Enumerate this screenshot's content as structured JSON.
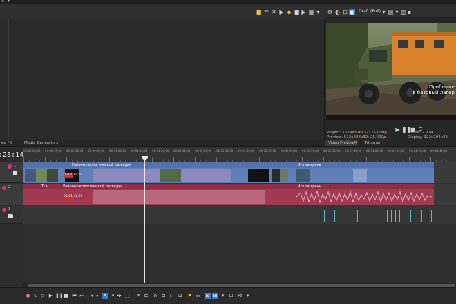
{
  "preview": {
    "quality": "Draft (Full)",
    "overlay_text_line1": "Прибытие",
    "overlay_text_line2": "в базовый лагер",
    "project_label": "Project:",
    "project_value": "1024x576x32; 25,000p",
    "preview_label": "Preview:",
    "preview_value": "512x288x32; 25,000p",
    "frame_label": "Frame:",
    "frame_value": "2 214",
    "display_label": "Display:",
    "display_value": "322x294x32"
  },
  "tabs": {
    "video_fx": "eo FX",
    "media_generators": "Media Generators",
    "video_preview": "Video Preview",
    "trimmer": "Trimmer"
  },
  "timeline": {
    "timecode": ":28:14",
    "ruler_labels": [
      "00:00:00;00",
      "00:00:15;00",
      "00:00:30;00",
      "00:00:45;00",
      "00:01:00;00",
      "00:01:15;00",
      "00:01:30;00",
      "00:01:45;00",
      "00:02:00;00",
      "00:02:15;00",
      "00:02:30;00",
      "00:02:45;00",
      "00:03:00;00",
      "00:03:15;00",
      "00:03:30;00",
      "00:03:45;00",
      "00:04:00;00",
      "00:04:15;00",
      "00:04:30;00",
      "00:04:45;00"
    ],
    "video_clip_1": "Районы геологической разведки",
    "video_clip_2": "Что за хрень",
    "audio_clip_short": "Тга...",
    "audio_clip_1": "Районы геологической разведки",
    "audio_clip_2": "Что за хрень",
    "marker_1": "00:01:40;01",
    "marker_2": "00:01:40;01",
    "track_1_num": "1",
    "track_2_num": "2",
    "track_3_num": "3"
  },
  "colors": {
    "video_track": "#6f8ec4",
    "audio_track": "#a64258",
    "accent": "#3a78c0"
  }
}
